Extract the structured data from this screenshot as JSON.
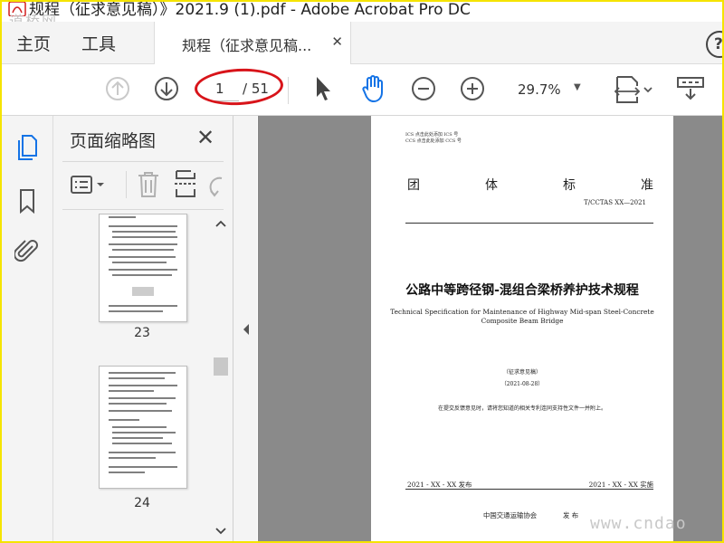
{
  "window": {
    "title": "规程（征求意见稿）》2021.9 (1).pdf - Adobe Acrobat Pro DC"
  },
  "watermark": {
    "logo_text": "道桥网",
    "site": "www.cndao"
  },
  "menu": {
    "home": "主页",
    "tools": "工具",
    "doc_tab": "规程（征求意见稿...",
    "doc_tab_close": "✕",
    "help": "?"
  },
  "toolbar": {
    "page_current": "1",
    "page_total": "/ 51",
    "zoom": "29.7%",
    "zoom_caret": "▼"
  },
  "panel": {
    "title": "页面缩略图",
    "close": "✕",
    "thumbnails": [
      {
        "label": "23"
      },
      {
        "label": "24"
      }
    ]
  },
  "document": {
    "ics_line": "ICS  点击此处添加 ICS 号",
    "ccs_line": "CCS  点击此处添加 CCS 号",
    "std_chars": [
      "团",
      "体",
      "标",
      "准"
    ],
    "std_code": "T/CCTAS  XX—2021",
    "title_cn": "公路中等跨径钢-混组合梁桥养护技术规程",
    "title_en_1": "Technical Specification for Maintenance of Highway Mid-span Steel-Concrete",
    "title_en_2": "Composite Beam Bridge",
    "draft_label": "（征求意见稿）",
    "draft_date": "（2021-08-28）",
    "notice": "在提交反馈意见时，请将您知道的相关专利连同支持性文件一并附上。",
    "release": "2021 - XX - XX 发布",
    "implement": "2021 - XX - XX 实施",
    "publisher": "中国交通运输协会",
    "publisher_action": "发  布"
  },
  "colors": {
    "accent_blue": "#1473e6",
    "annotation_red": "#d8141a",
    "frame_yellow": "#f5e400",
    "doc_background": "#8a8a8a"
  }
}
